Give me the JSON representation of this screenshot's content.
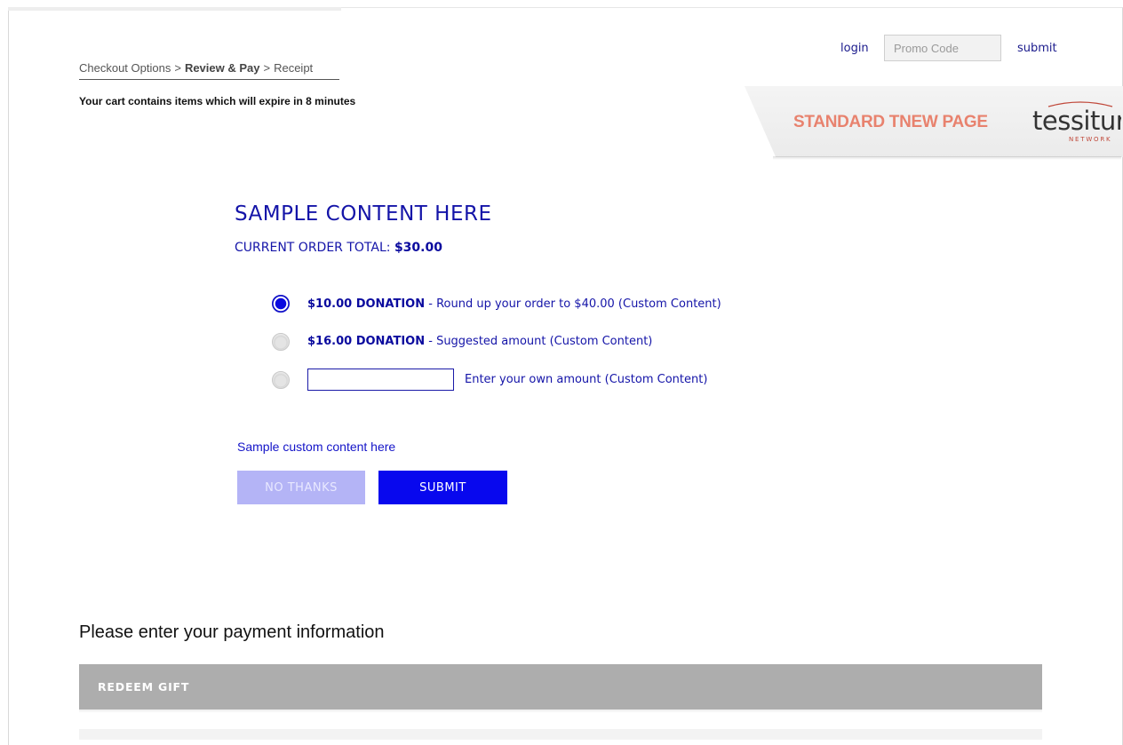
{
  "header": {
    "login_label": "login",
    "promo_placeholder": "Promo Code",
    "submit_label": "submit"
  },
  "breadcrumb": {
    "steps": [
      "Checkout Options",
      "Review & Pay",
      "Receipt"
    ],
    "separator": ">",
    "current_index": 1
  },
  "cart_warning": "Your cart contains items which will expire in 8 minutes",
  "banner": {
    "title": "STANDARD TNEW PAGE",
    "logo_word": "tessitura",
    "logo_sub": "NETWORK"
  },
  "donation": {
    "heading": "SAMPLE CONTENT HERE",
    "order_total_label": "CURRENT ORDER TOTAL:",
    "order_total_value": "$30.00",
    "options": [
      {
        "amount": "$10.00 DONATION",
        "description": " - Round up your order to $40.00 (Custom Content)",
        "selected": true
      },
      {
        "amount": "$16.00 DONATION",
        "description": " - Suggested amount (Custom Content)",
        "selected": false
      },
      {
        "amount": "",
        "description": "Enter your own amount (Custom Content)",
        "selected": false,
        "custom_value": ""
      }
    ],
    "custom_content": "Sample custom content here",
    "no_thanks_label": "NO THANKS",
    "submit_label": "SUBMIT"
  },
  "payment": {
    "heading": "Please enter your payment information",
    "redeem_gift_label": "REDEEM GIFT"
  },
  "colors": {
    "primary_blue": "#0808ee",
    "text_blue": "#1414a8",
    "disabled_button": "#b4b4f6",
    "banner_title": "#e8826e",
    "section_bar": "#adadad"
  }
}
